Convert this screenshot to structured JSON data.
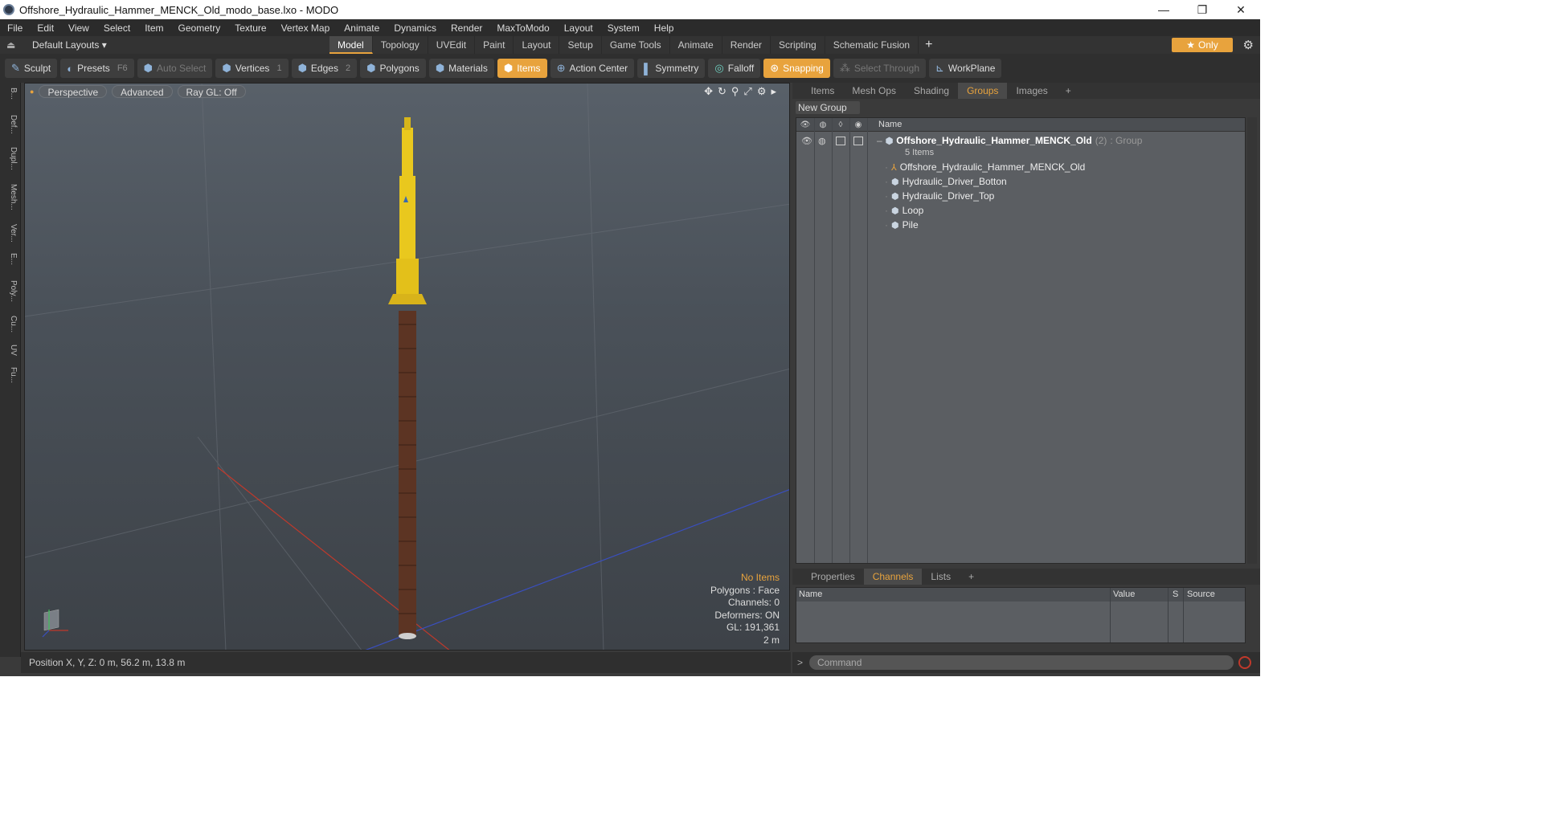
{
  "window": {
    "title": "Offshore_Hydraulic_Hammer_MENCK_Old_modo_base.lxo - MODO",
    "minimize": "—",
    "maximize": "❐",
    "close": "✕"
  },
  "menu": [
    "File",
    "Edit",
    "View",
    "Select",
    "Item",
    "Geometry",
    "Texture",
    "Vertex Map",
    "Animate",
    "Dynamics",
    "Render",
    "MaxToModo",
    "Layout",
    "System",
    "Help"
  ],
  "layoutbar": {
    "layouts_label": "Default Layouts ▾",
    "tabs": [
      "Model",
      "Topology",
      "UVEdit",
      "Paint",
      "Layout",
      "Setup",
      "Game Tools",
      "Animate",
      "Render",
      "Scripting",
      "Schematic Fusion"
    ],
    "active_tab": "Model",
    "plus": "+",
    "only_label": "Only",
    "star": "★"
  },
  "toolbar": {
    "sculpt": "Sculpt",
    "presets": "Presets",
    "presets_key": "F6",
    "auto_select": "Auto Select",
    "vertices": "Vertices",
    "vertices_count": "1",
    "edges": "Edges",
    "edges_count": "2",
    "polygons": "Polygons",
    "materials": "Materials",
    "items": "Items",
    "action_center": "Action Center",
    "symmetry": "Symmetry",
    "falloff": "Falloff",
    "snapping": "Snapping",
    "select_through": "Select Through",
    "workplane": "WorkPlane"
  },
  "leftstrip": [
    "B...",
    "Def...",
    "Dupl...",
    "Mesh...",
    "Ver...",
    "E...",
    "Poly...",
    "Cu...",
    "UV",
    "Fu..."
  ],
  "viewport": {
    "perspective": "Perspective",
    "advanced": "Advanced",
    "raygl": "Ray GL: Off",
    "stats": {
      "no_items": "No Items",
      "polygons": "Polygons : Face",
      "channels": "Channels: 0",
      "deformers": "Deformers: ON",
      "gl": "GL: 191,361",
      "scale": "2 m"
    }
  },
  "status": {
    "position": "Position X, Y, Z:   0 m, 56.2 m, 13.8 m"
  },
  "groups_panel": {
    "tabs": [
      "Items",
      "Mesh Ops",
      "Shading",
      "Groups",
      "Images"
    ],
    "active_tab": "Groups",
    "plus": "+",
    "new_group": "New Group",
    "name_header": "Name",
    "group": {
      "name": "Offshore_Hydraulic_Hammer_MENCK_Old",
      "count": "(2)",
      "type": ": Group",
      "items_count": "5 Items"
    },
    "items": [
      "Offshore_Hydraulic_Hammer_MENCK_Old",
      "Hydraulic_Driver_Botton",
      "Hydraulic_Driver_Top",
      "Loop",
      "Pile"
    ]
  },
  "channels_panel": {
    "tabs": [
      "Properties",
      "Channels",
      "Lists"
    ],
    "active_tab": "Channels",
    "plus": "+",
    "headers": {
      "name": "Name",
      "value": "Value",
      "s": "S",
      "source": "Source"
    }
  },
  "command": {
    "prompt": ">",
    "placeholder": "Command"
  },
  "colors": {
    "accent": "#e8a33d",
    "hammer_yellow": "#e9c81e",
    "pile_brown": "#5c3423"
  }
}
